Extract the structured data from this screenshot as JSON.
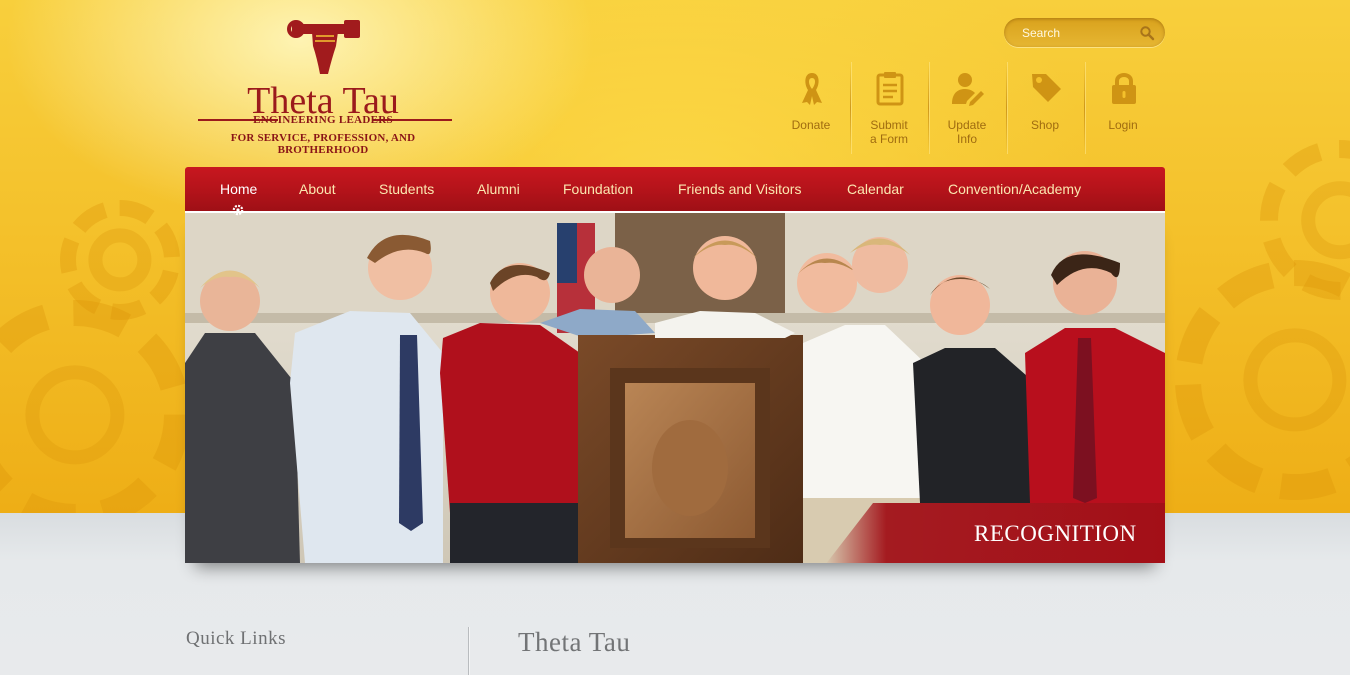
{
  "brand": {
    "name": "Theta Tau",
    "tagline_1": "ENGINEERING LEADERS",
    "tagline_2": "FOR SERVICE, PROFESSION, AND BROTHERHOOD",
    "logo_icon": "hammer-fist-emblem-icon",
    "color_primary": "#9b1a1c",
    "color_gold": "#f4c12b"
  },
  "search": {
    "placeholder": "Search",
    "icon": "search-icon"
  },
  "utility_links": [
    {
      "label": "Donate",
      "icon": "ribbon-icon"
    },
    {
      "label": "Submit\na Form",
      "icon": "clipboard-icon"
    },
    {
      "label": "Update\nInfo",
      "icon": "user-edit-icon"
    },
    {
      "label": "Shop",
      "icon": "tag-icon"
    },
    {
      "label": "Login",
      "icon": "lock-icon"
    }
  ],
  "nav": {
    "items": [
      {
        "label": "Home",
        "active": true
      },
      {
        "label": "About"
      },
      {
        "label": "Students"
      },
      {
        "label": "Alumni"
      },
      {
        "label": "Foundation"
      },
      {
        "label": "Friends and Visitors"
      },
      {
        "label": "Calendar"
      },
      {
        "label": "Convention/Academy"
      }
    ],
    "active_indicator_icon": "gear-icon"
  },
  "slider": {
    "caption": "RECOGNITION"
  },
  "sections": {
    "quick_links_title": "Quick Links",
    "main_title": "Theta Tau"
  }
}
